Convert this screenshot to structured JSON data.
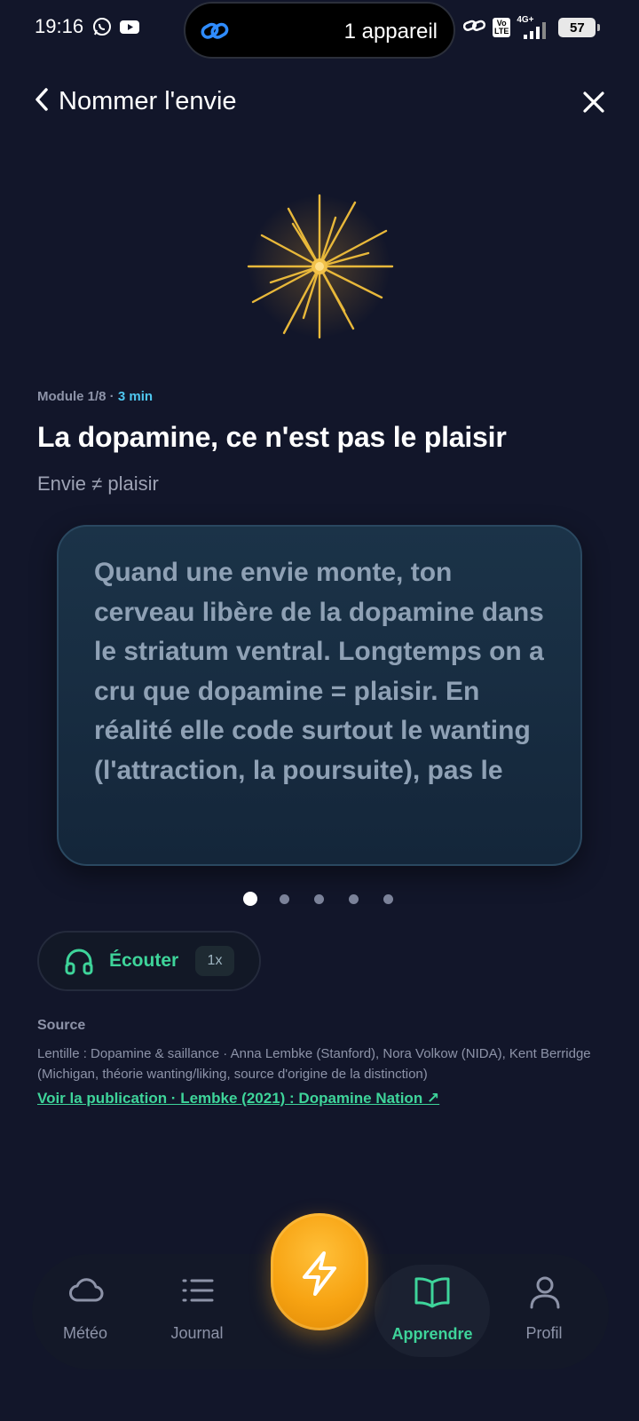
{
  "status_bar": {
    "time": "19:16",
    "island_label": "1 appareil",
    "network": "4G+",
    "battery": "57",
    "volte": "Vo LTE"
  },
  "header": {
    "title": "Nommer l'envie"
  },
  "lesson": {
    "module": "Module 1/8 · ",
    "duration": "3 min",
    "title": "La dopamine, ce n'est pas le plaisir",
    "subtitle": "Envie ≠ plaisir",
    "card_text": "Quand une envie monte, ton cerveau libère de la dopamine dans le striatum ventral. Longtemps on a cru que dopamine = plaisir. En réalité elle code surtout le wanting (l'attraction, la poursuite), pas le",
    "page_count": 5,
    "current_page": 1
  },
  "listen": {
    "label": "Écouter",
    "speed": "1x"
  },
  "source": {
    "heading": "Source",
    "text": "Lentille : Dopamine & saillance · Anna Lembke (Stanford), Nora Volkow (NIDA), Kent Berridge (Michigan, théorie wanting/liking, source d'origine de la distinction)",
    "link": "Voir la publication · Lembke (2021) : Dopamine Nation ↗"
  },
  "nav": {
    "items": [
      {
        "label": "Météo",
        "icon": "cloud-icon"
      },
      {
        "label": "Journal",
        "icon": "list-icon"
      },
      {
        "label": "Apprendre",
        "icon": "book-icon",
        "active": true
      },
      {
        "label": "Profil",
        "icon": "user-icon"
      }
    ],
    "fab_icon": "lightning-icon"
  },
  "colors": {
    "background": "#12162a",
    "accent_green": "#3ed49a",
    "accent_blue": "#4fc7f0",
    "fab_orange": "#f7a312",
    "hero_gold": "#e8b83a"
  }
}
